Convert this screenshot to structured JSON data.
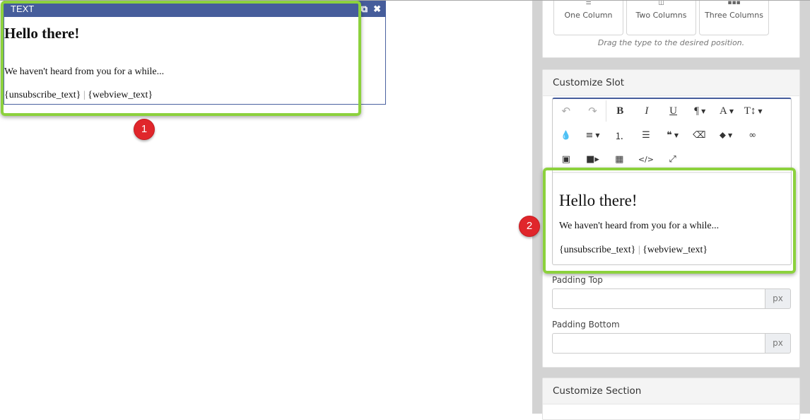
{
  "canvas": {
    "slot": {
      "type_label": "TEXT",
      "actions": {
        "clone_icon": "clone-icon",
        "close_icon": "close-icon"
      },
      "heading": "Hello there!",
      "message": "We haven't heard from you for a while...",
      "footer_unsubscribe": "{unsubscribe_text}",
      "footer_separator": "|",
      "footer_webview": "{webview_text}"
    },
    "annotation_1": "1"
  },
  "sidebar": {
    "layout_panel": {
      "columns": [
        {
          "label": "One Column",
          "icon": "one-column-icon"
        },
        {
          "label": "Two Columns",
          "icon": "two-columns-icon"
        },
        {
          "label": "Three Columns",
          "icon": "three-columns-icon"
        }
      ],
      "hint": "Drag the type to the desired position."
    },
    "customize_slot": {
      "title": "Customize Slot",
      "toolbar": {
        "row1": [
          "undo",
          "redo",
          "bold",
          "italic",
          "underline",
          "paragraph",
          "font-color",
          "font-size"
        ],
        "row2": [
          "color-drop",
          "align",
          "ordered-list",
          "unordered-list",
          "blockquote",
          "eraser",
          "tag",
          "link"
        ],
        "row3": [
          "image",
          "video",
          "table",
          "code-view",
          "fullscreen"
        ]
      },
      "editor": {
        "heading": "Hello there!",
        "message": "We haven't heard from you for a while...",
        "footer_unsubscribe": "{unsubscribe_text}",
        "footer_separator": "|",
        "footer_webview": "{webview_text}"
      },
      "padding_top": {
        "label": "Padding Top",
        "value": "",
        "unit": "px"
      },
      "padding_bottom": {
        "label": "Padding Bottom",
        "value": "",
        "unit": "px"
      }
    },
    "customize_section": {
      "title": "Customize Section"
    },
    "annotation_2": "2"
  },
  "colors": {
    "slot_header": "#465d9b",
    "highlight": "#8cd13d",
    "badge": "#e0262b",
    "sidebar_bg": "#d3d3d3"
  }
}
